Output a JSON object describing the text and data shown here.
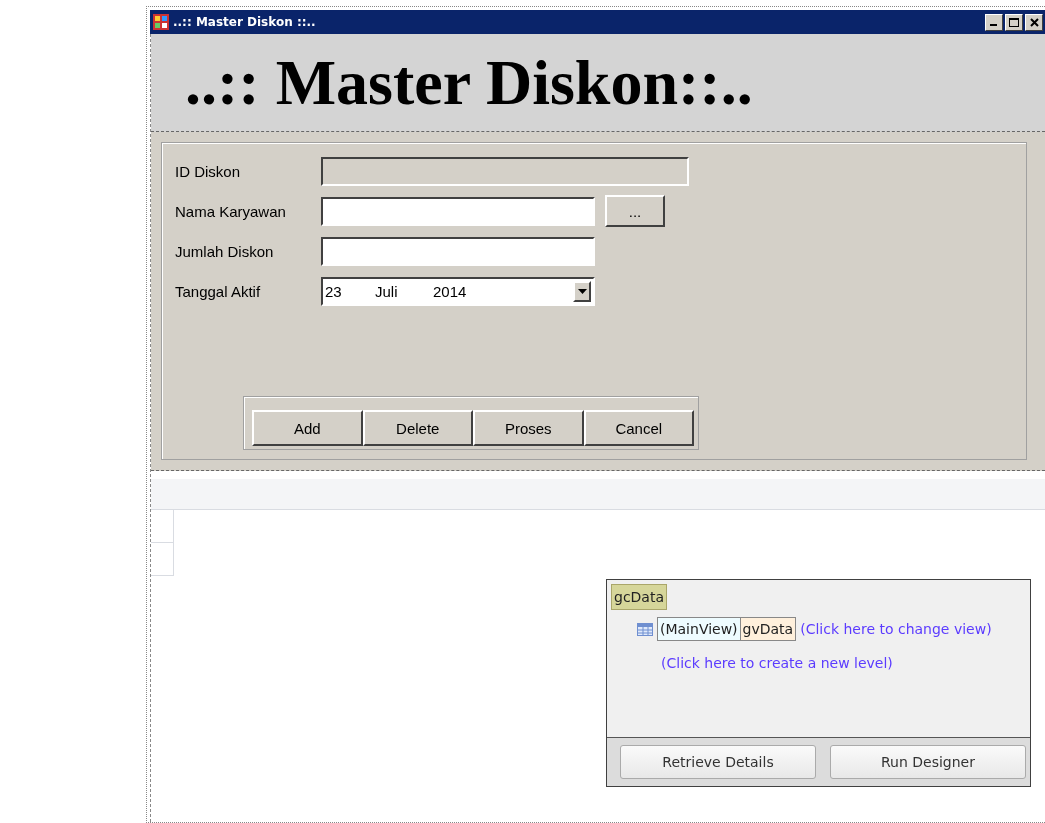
{
  "window": {
    "title": "..:: Master Diskon ::.."
  },
  "header": {
    "title": "..:: Master Diskon::.."
  },
  "form": {
    "fields": [
      {
        "label": "ID Diskon",
        "kind": "readonly",
        "disabled": true
      },
      {
        "label": "Nama Karyawan",
        "kind": "lookup",
        "button": "..."
      },
      {
        "label": "Jumlah Diskon",
        "kind": "text"
      },
      {
        "label": "Tanggal Aktif",
        "kind": "date",
        "day": "23",
        "month": "Juli",
        "year": "2014"
      }
    ],
    "buttons": [
      "Add",
      "Delete",
      "Proses",
      "Cancel"
    ]
  },
  "grid_designer": {
    "control": "gcData",
    "view": "(MainView)",
    "view_name": "gvData",
    "change_view_link": "(Click here to change view)",
    "new_level_link": "(Click here to create a new level)",
    "buttons": [
      "Retrieve Details",
      "Run Designer"
    ]
  }
}
